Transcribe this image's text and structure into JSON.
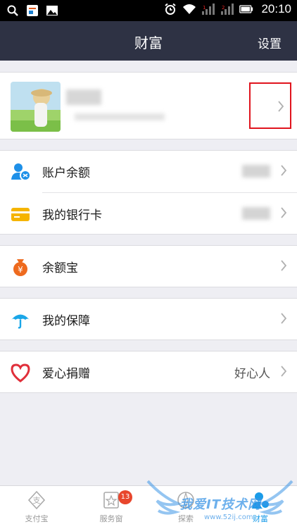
{
  "status_bar": {
    "time": "20:10",
    "icons": [
      "search-icon",
      "app-icon",
      "gallery-icon",
      "alarm-icon",
      "wifi-icon",
      "signal-icon",
      "signal-icon",
      "battery-icon"
    ]
  },
  "nav": {
    "title": "财富",
    "settings": "设置"
  },
  "menu": [
    {
      "label": "账户余额",
      "icon": "account-balance-icon",
      "color": "#1e90e8"
    },
    {
      "label": "我的银行卡",
      "icon": "bank-card-icon",
      "color": "#f5b400"
    },
    {
      "label": "余额宝",
      "icon": "money-bag-icon",
      "color": "#ee6a1e"
    },
    {
      "label": "我的保障",
      "icon": "umbrella-icon",
      "color": "#1aa6e8"
    },
    {
      "label": "爱心捐赠",
      "icon": "heart-icon",
      "color": "#e02f3a",
      "value": "好心人"
    }
  ],
  "tabs": [
    {
      "label": "支付宝",
      "icon": "alipay-icon"
    },
    {
      "label": "服务窗",
      "icon": "service-window-icon",
      "badge": "13"
    },
    {
      "label": "探索",
      "icon": "explore-icon"
    },
    {
      "label": "财富",
      "icon": "wealth-icon",
      "active": true
    }
  ],
  "watermark": {
    "text": "我爱IT技术网",
    "sub": "www.52ij.com"
  }
}
